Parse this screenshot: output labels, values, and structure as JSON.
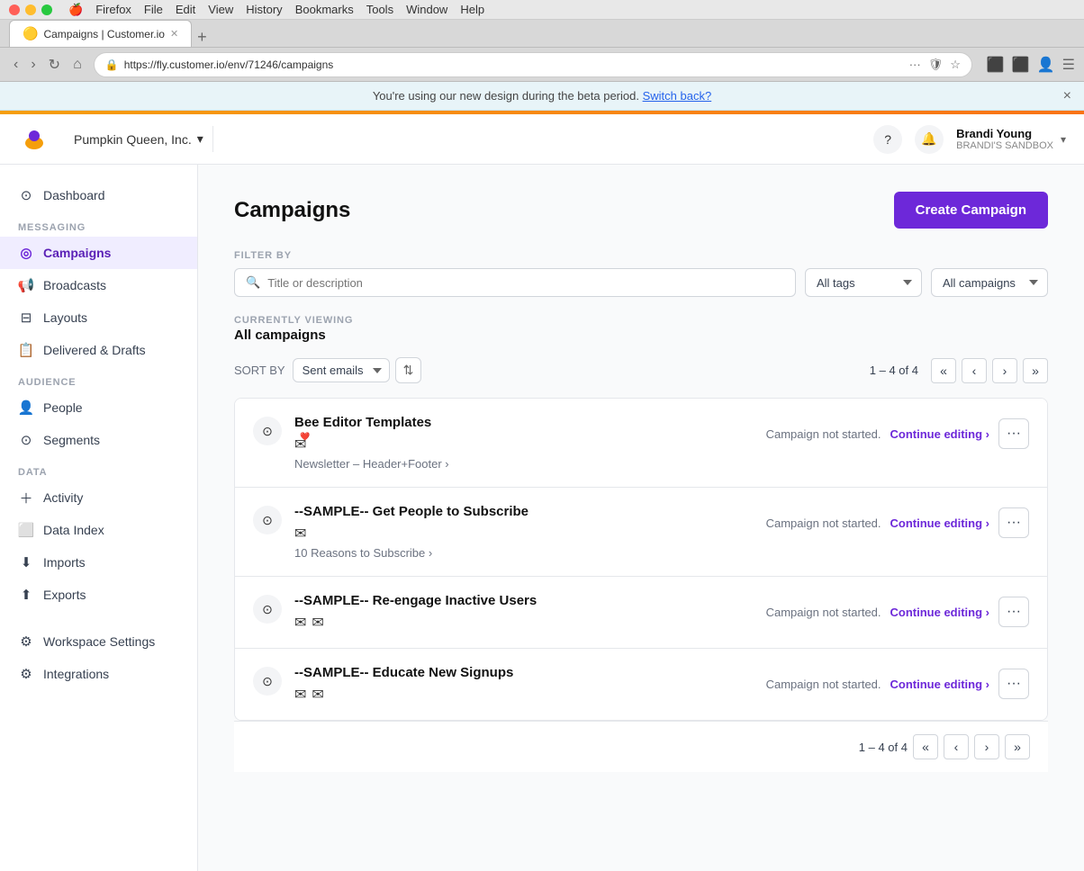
{
  "macbar": {
    "apple": "🍎",
    "menus": [
      "Firefox",
      "File",
      "Edit",
      "View",
      "History",
      "Bookmarks",
      "Tools",
      "Window",
      "Help"
    ]
  },
  "browser": {
    "tab_title": "Campaigns | Customer.io",
    "url": "https://fly.customer.io/env/71246/campaigns",
    "tab_new_label": "+"
  },
  "beta_banner": {
    "text": "You're using our new design during the beta period.",
    "link_text": "Switch back?",
    "close_label": "×"
  },
  "header": {
    "workspace": "Pumpkin Queen, Inc.",
    "workspace_chevron": "▾",
    "help_icon": "?",
    "bell_icon": "🔔",
    "user_name": "Brandi Young",
    "user_sandbox": "BRANDI'S SANDBOX",
    "user_chevron": "▾"
  },
  "sidebar": {
    "sections": [
      {
        "label": "",
        "items": [
          {
            "id": "dashboard",
            "icon": "⊙",
            "label": "Dashboard"
          }
        ]
      },
      {
        "label": "MESSAGING",
        "items": [
          {
            "id": "campaigns",
            "icon": "◎",
            "label": "Campaigns",
            "active": true
          },
          {
            "id": "broadcasts",
            "icon": "📢",
            "label": "Broadcasts"
          },
          {
            "id": "layouts",
            "icon": "⬜",
            "label": "Layouts"
          },
          {
            "id": "delivered",
            "icon": "📋",
            "label": "Delivered & Drafts"
          }
        ]
      },
      {
        "label": "AUDIENCE",
        "items": [
          {
            "id": "people",
            "icon": "👤",
            "label": "People"
          },
          {
            "id": "segments",
            "icon": "⊙",
            "label": "Segments"
          }
        ]
      },
      {
        "label": "DATA",
        "items": [
          {
            "id": "activity",
            "icon": "＋",
            "label": "Activity"
          },
          {
            "id": "data-index",
            "icon": "⬜",
            "label": "Data Index"
          },
          {
            "id": "imports",
            "icon": "⬇",
            "label": "Imports"
          },
          {
            "id": "exports",
            "icon": "⬆",
            "label": "Exports"
          }
        ]
      },
      {
        "label": "",
        "items": [
          {
            "id": "workspace-settings",
            "icon": "⚙",
            "label": "Workspace Settings"
          },
          {
            "id": "integrations",
            "icon": "⚙",
            "label": "Integrations"
          }
        ]
      }
    ]
  },
  "main": {
    "page_title": "Campaigns",
    "create_button": "Create Campaign",
    "filter": {
      "label": "FILTER BY",
      "search_placeholder": "Title or description",
      "tags_default": "All tags",
      "campaigns_default": "All campaigns"
    },
    "currently_viewing": {
      "label": "CURRENTLY VIEWING",
      "value": "All campaigns"
    },
    "sort": {
      "label": "SORT BY",
      "default": "Sent emails",
      "pagination_info": "1 – 4 of 4"
    },
    "campaigns": [
      {
        "id": "bee-editor",
        "name": "Bee Editor Templates",
        "email_icons": [
          "✉"
        ],
        "meta": "Newsletter – Header+Footer ›",
        "status": "Campaign not started.",
        "action": "Continue editing ›"
      },
      {
        "id": "sample-subscribe",
        "name": "--SAMPLE-- Get People to Subscribe",
        "email_icons": [
          "✉"
        ],
        "meta": "10 Reasons to Subscribe ›",
        "status": "Campaign not started.",
        "action": "Continue editing ›"
      },
      {
        "id": "sample-reengage",
        "name": "--SAMPLE-- Re-engage Inactive Users",
        "email_icons": [
          "✉",
          "✉"
        ],
        "meta": "",
        "status": "Campaign not started.",
        "action": "Continue editing ›"
      },
      {
        "id": "sample-educate",
        "name": "--SAMPLE-- Educate New Signups",
        "email_icons": [
          "✉",
          "✉"
        ],
        "meta": "",
        "status": "Campaign not started.",
        "action": "Continue editing ›"
      }
    ],
    "bottom_pagination": "1 – 4 of 4"
  }
}
